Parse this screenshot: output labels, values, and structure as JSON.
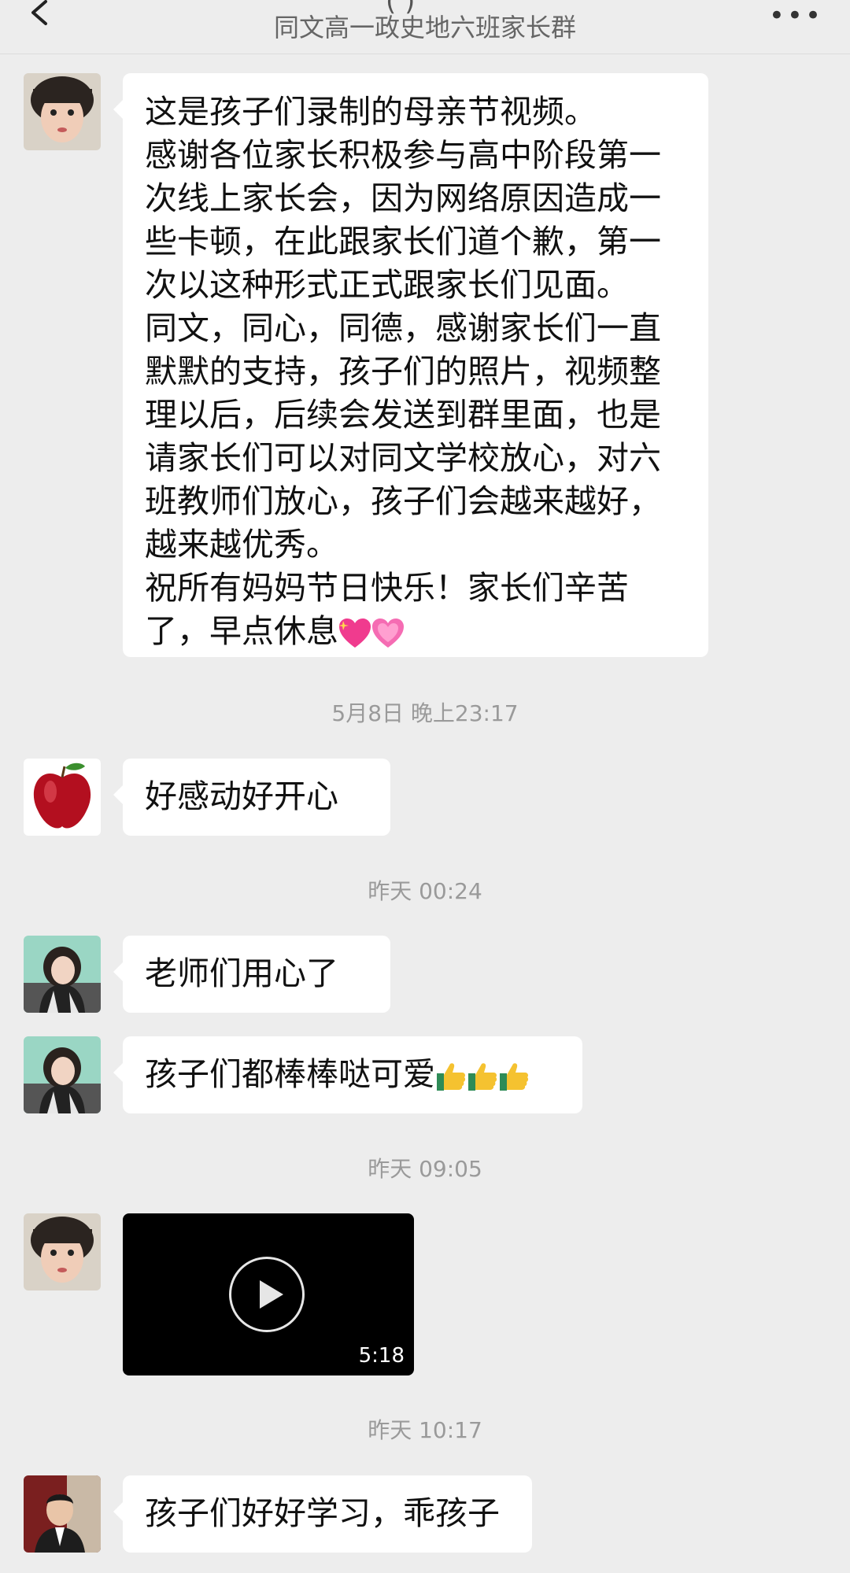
{
  "header": {
    "title": "同文高一政史地六班家长群",
    "top_partial": "( )",
    "more_label": "•••"
  },
  "messages": [
    {
      "text": "这是孩子们录制的母亲节视频。\n感谢各位家长积极参与高中阶段第一次线上家长会，因为网络原因造成一些卡顿，在此跟家长们道个歉，第一次以这种形式正式跟家长们见面。\n同文，同心，同德，感谢家长们一直默默的支持，孩子们的照片，视频整理以后，后续会发送到群里面，也是请家长们可以对同文学校放心，对六班教师们放心，孩子们会越来越好，越来越优秀。\n祝所有妈妈节日快乐！家长们辛苦了，早点休息"
    },
    {
      "text": "好感动好开心"
    },
    {
      "text": "老师们用心了"
    },
    {
      "text": "孩子们都棒棒哒可爱"
    },
    {
      "video_duration": "5:18"
    },
    {
      "text": "孩子们好好学习，乖孩子"
    }
  ],
  "timestamps": [
    "5月8日 晚上23:17",
    "昨天 00:24",
    "昨天 09:05",
    "昨天 10:17"
  ],
  "colors": {
    "background": "#ededed",
    "bubble": "#ffffff",
    "timestamp": "#9a9a9a",
    "video": "#000000"
  }
}
